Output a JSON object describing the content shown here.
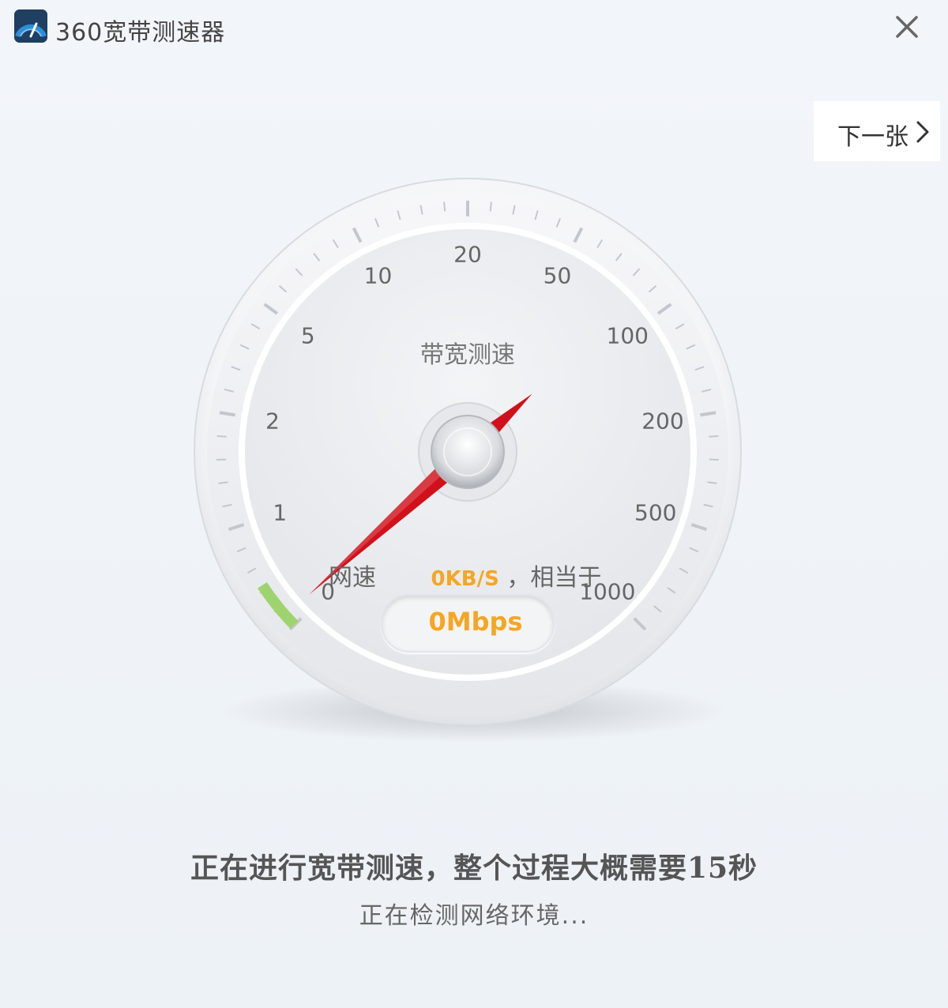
{
  "window": {
    "title": "360宽带测速器",
    "logo_icon": "speedometer-logo-icon",
    "close_icon": "close-icon"
  },
  "navigation": {
    "next_label": "下一张",
    "next_icon": "chevron-right-icon"
  },
  "gauge": {
    "title": "带宽测速",
    "scale_labels": [
      "0",
      "1",
      "2",
      "5",
      "10",
      "20",
      "50",
      "100",
      "200",
      "500",
      "1000"
    ],
    "current_scale_value": 0,
    "speed_label": "网速",
    "speed_kbs": "0KB/S",
    "speed_suffix": "，相当于",
    "speed_mbps": "0Mbps",
    "needle_color": "#d0111b",
    "accent_color": "#f5a623",
    "progress_color": "#9fd36f"
  },
  "status": {
    "main": "正在进行宽带测速，整个过程大概需要15秒",
    "sub": "正在检测网络环境..."
  }
}
